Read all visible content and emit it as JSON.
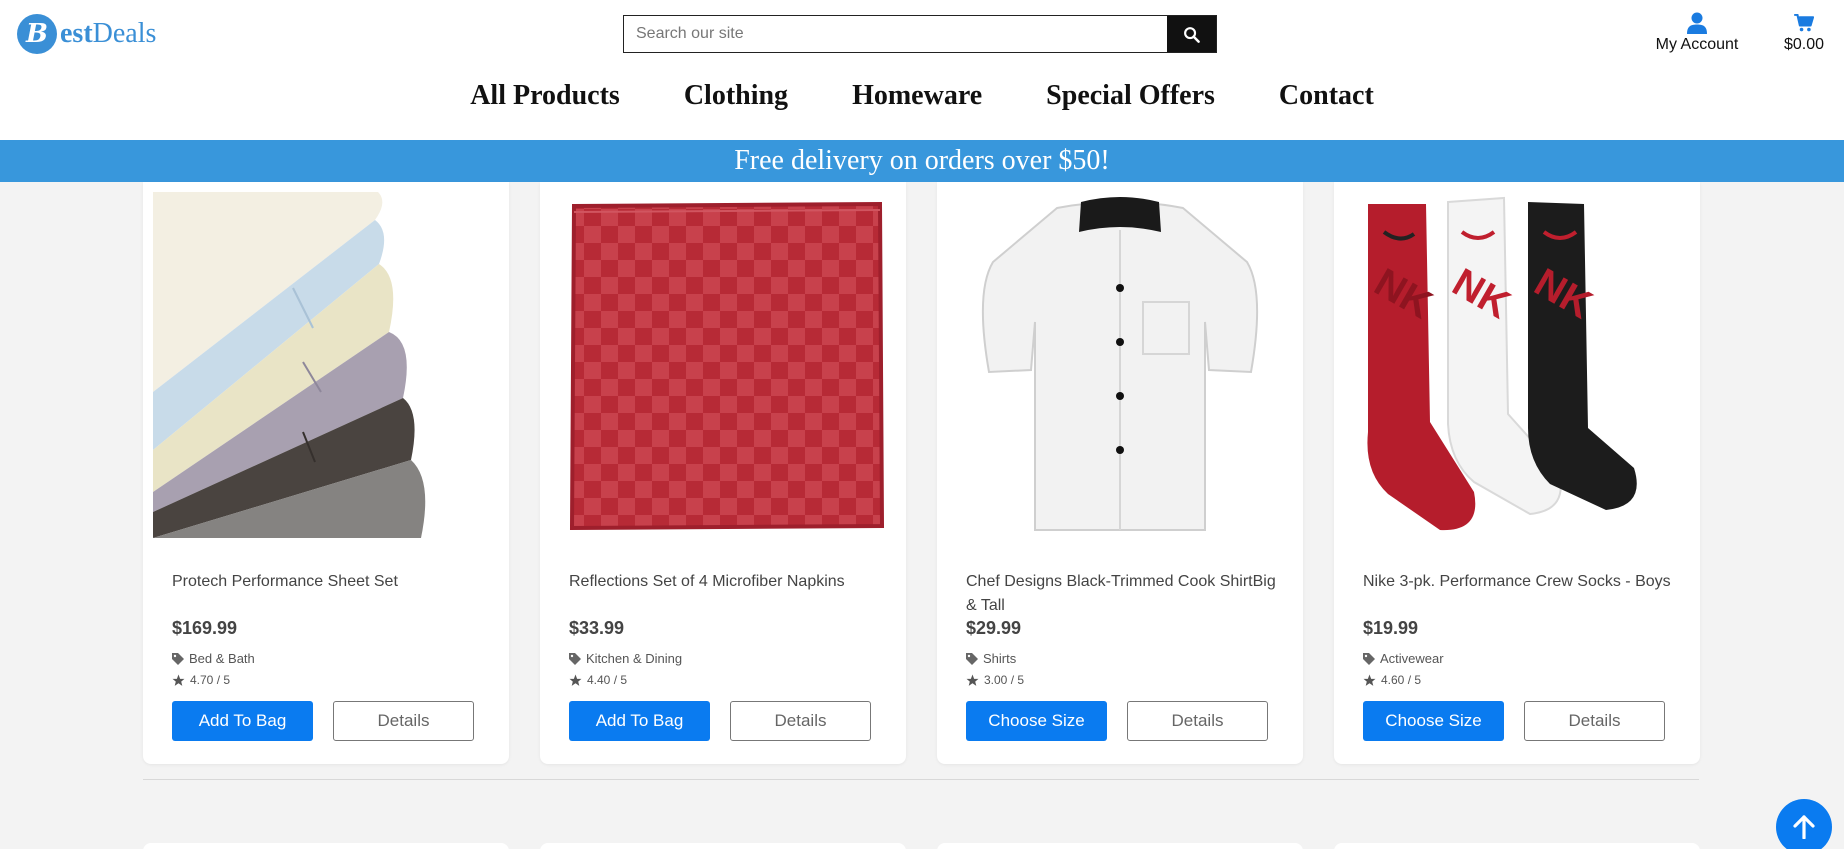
{
  "brand": {
    "logo_letter": "B",
    "name_bold": "est",
    "name_rest": "Deals",
    "color": "#3a8fd6"
  },
  "search": {
    "placeholder": "Search our site",
    "icon": "search-icon"
  },
  "account": {
    "label": "My Account",
    "icon": "user-icon"
  },
  "cart": {
    "total": "$0.00",
    "icon": "cart-icon"
  },
  "nav": {
    "items": [
      "All Products",
      "Clothing",
      "Homeware",
      "Special Offers",
      "Contact"
    ]
  },
  "banner": {
    "text": "Free delivery on orders over $50!",
    "color": "#3897dc"
  },
  "accent_color": "#0a7bf0",
  "products": [
    {
      "name": "Protech Performance Sheet Set",
      "price": "$169.99",
      "category": "Bed & Bath",
      "rating": "4.70 / 5",
      "primary_action": "Add To Bag",
      "secondary_action": "Details"
    },
    {
      "name": "Reflections Set of 4 Microfiber Napkins",
      "price": "$33.99",
      "category": "Kitchen & Dining",
      "rating": "4.40 / 5",
      "primary_action": "Add To Bag",
      "secondary_action": "Details"
    },
    {
      "name": "Chef Designs Black-Trimmed Cook ShirtBig & Tall",
      "price": "$29.99",
      "category": "Shirts",
      "rating": "3.00 / 5",
      "primary_action": "Choose Size",
      "secondary_action": "Details"
    },
    {
      "name": "Nike 3-pk. Performance Crew Socks - Boys",
      "price": "$19.99",
      "category": "Activewear",
      "rating": "4.60 / 5",
      "primary_action": "Choose Size",
      "secondary_action": "Details"
    }
  ],
  "scroll_top": {
    "icon": "arrow-up-icon"
  }
}
